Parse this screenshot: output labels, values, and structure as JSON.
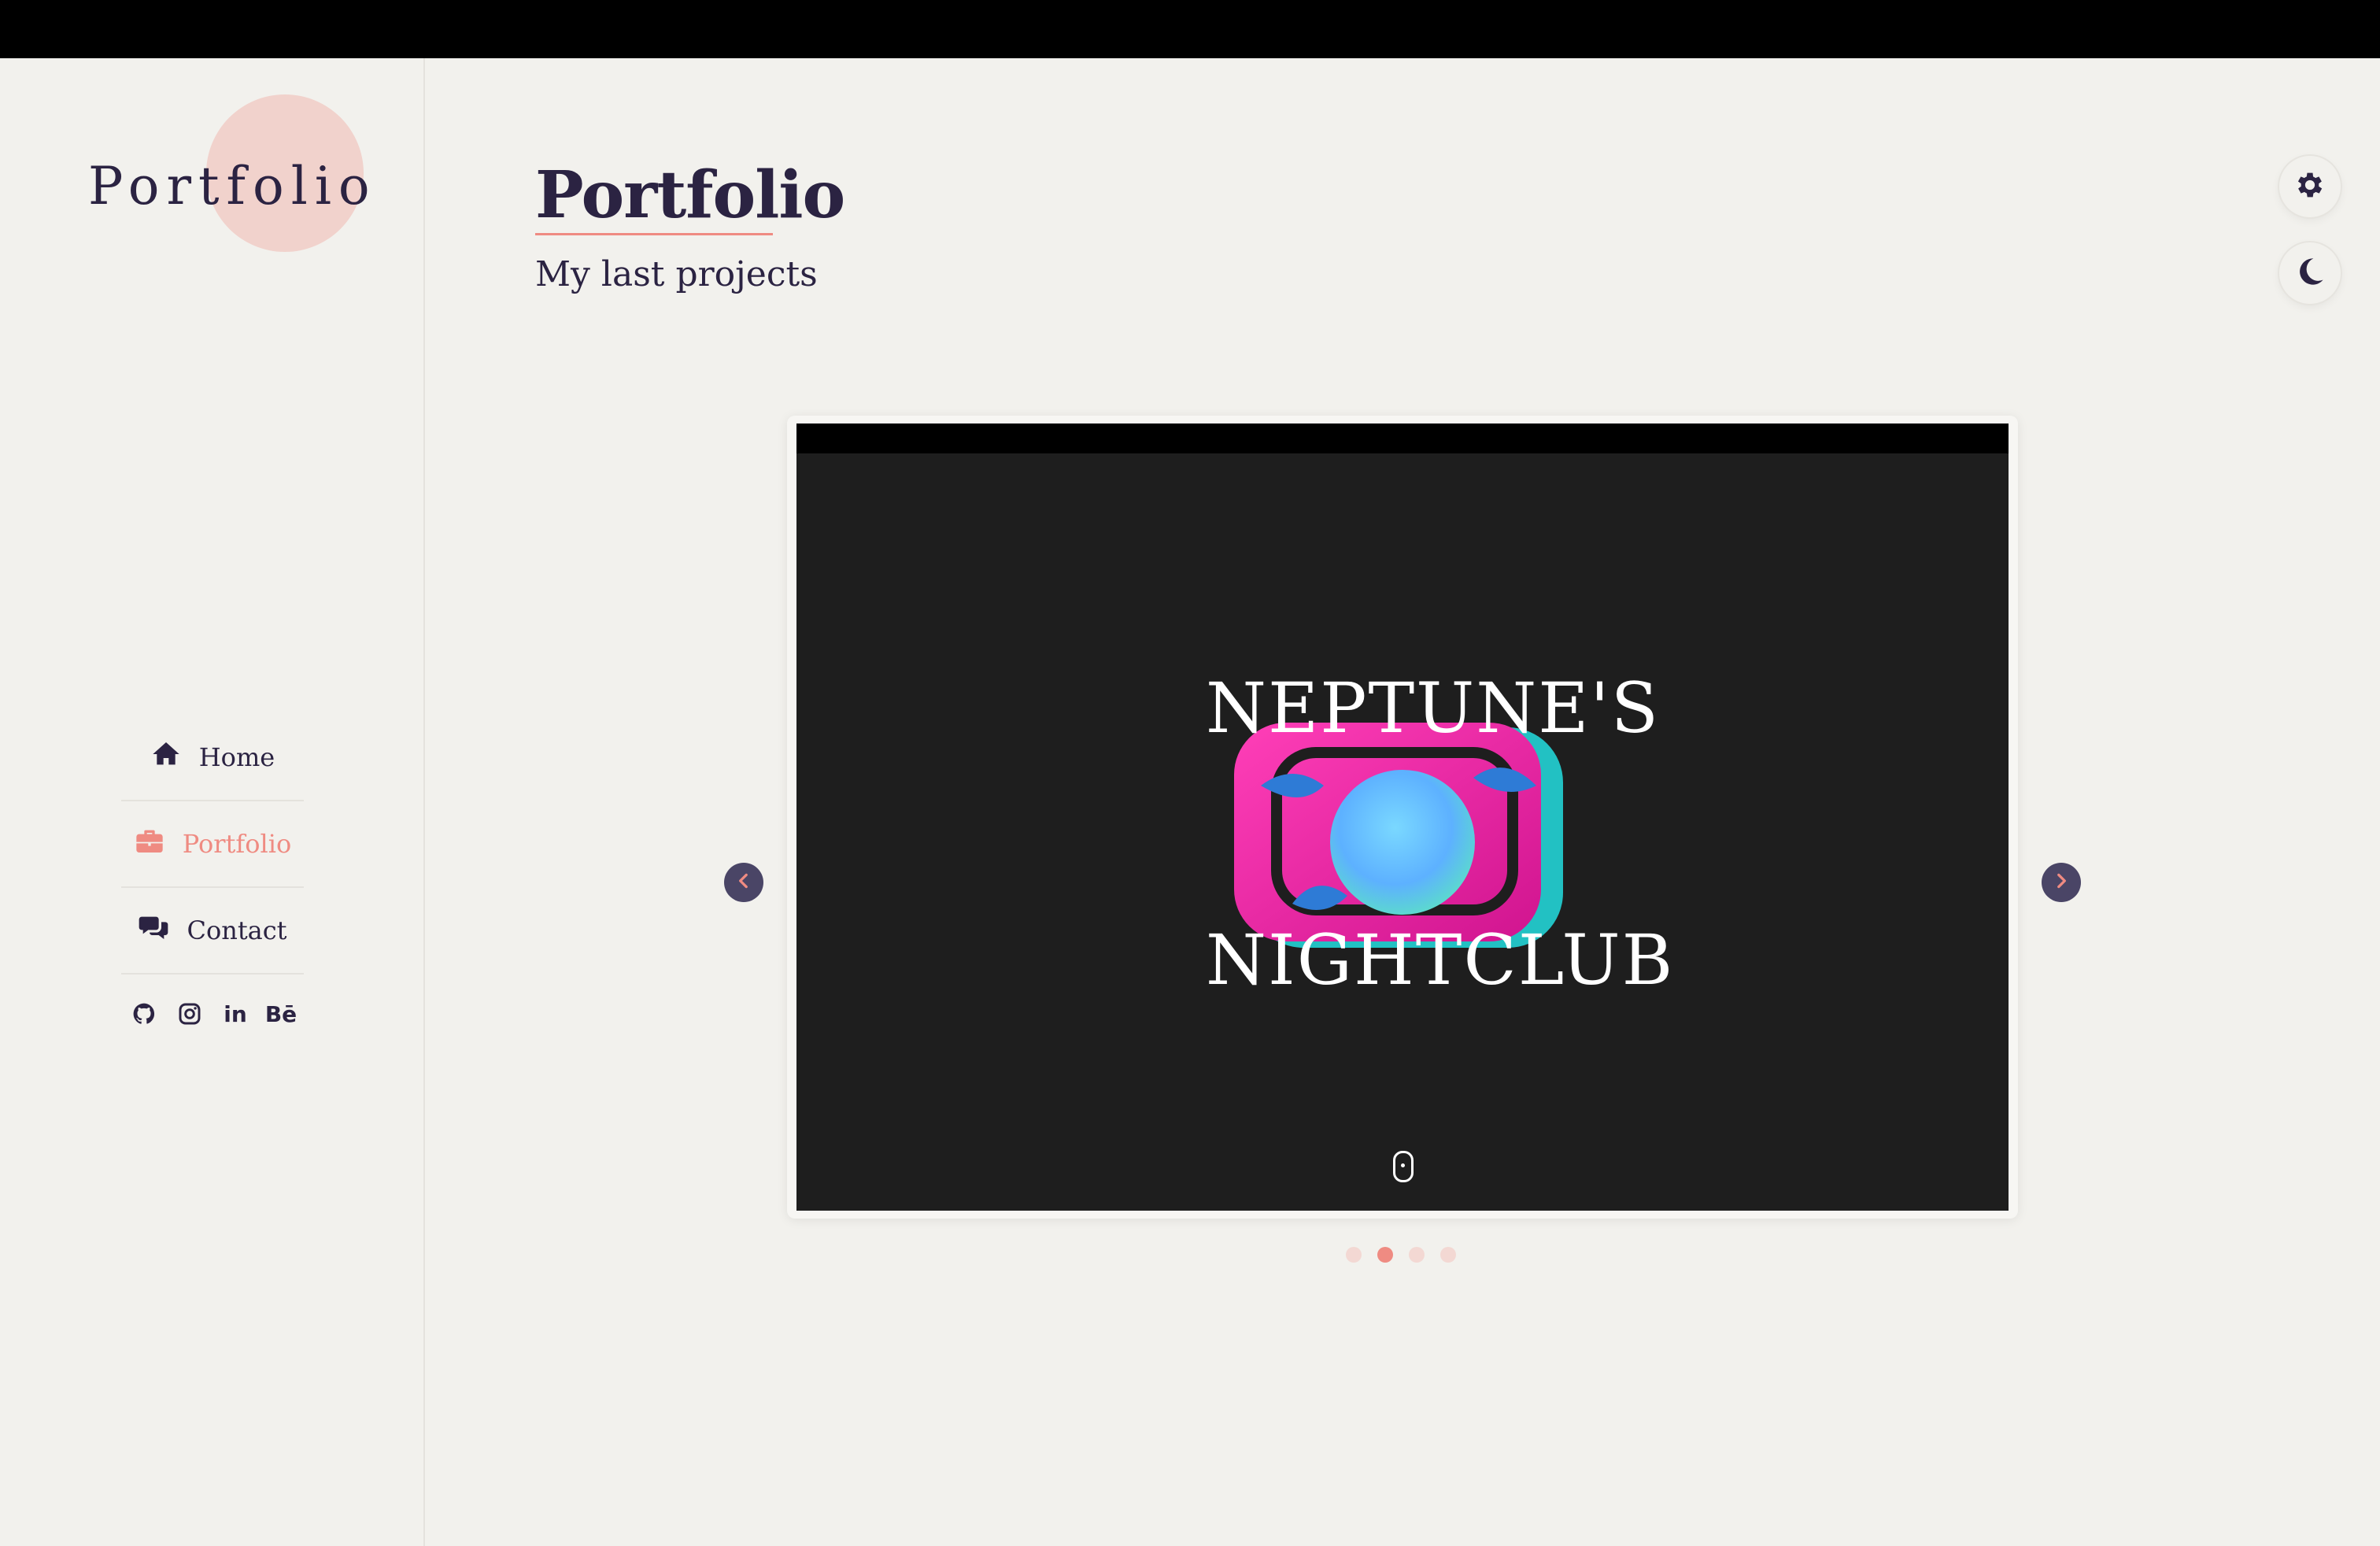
{
  "sidebar": {
    "logo_text": "Portfolio",
    "nav": [
      {
        "label": "Home",
        "icon": "home-icon"
      },
      {
        "label": "Portfolio",
        "icon": "briefcase-icon",
        "active": true
      },
      {
        "label": "Contact",
        "icon": "chat-icon"
      }
    ],
    "social": [
      {
        "icon": "github-icon"
      },
      {
        "icon": "instagram-icon"
      },
      {
        "icon": "linkedin-icon",
        "text": "in"
      },
      {
        "icon": "behance-icon",
        "text": "Bē"
      }
    ]
  },
  "header": {
    "title": "Portfolio",
    "subtitle": "My last projects"
  },
  "controls": {
    "settings_icon": "gear-icon",
    "theme_icon": "moon-icon"
  },
  "slider": {
    "slide": {
      "line1": "NEPTUNE'S",
      "line2": "NIGHTCLUB"
    },
    "dots_count": 4,
    "active_index": 1
  },
  "colors": {
    "accent": "#ef8b82",
    "text": "#2b2342",
    "background": "#f2f1ed",
    "slide_bg": "#1e1e1e"
  }
}
